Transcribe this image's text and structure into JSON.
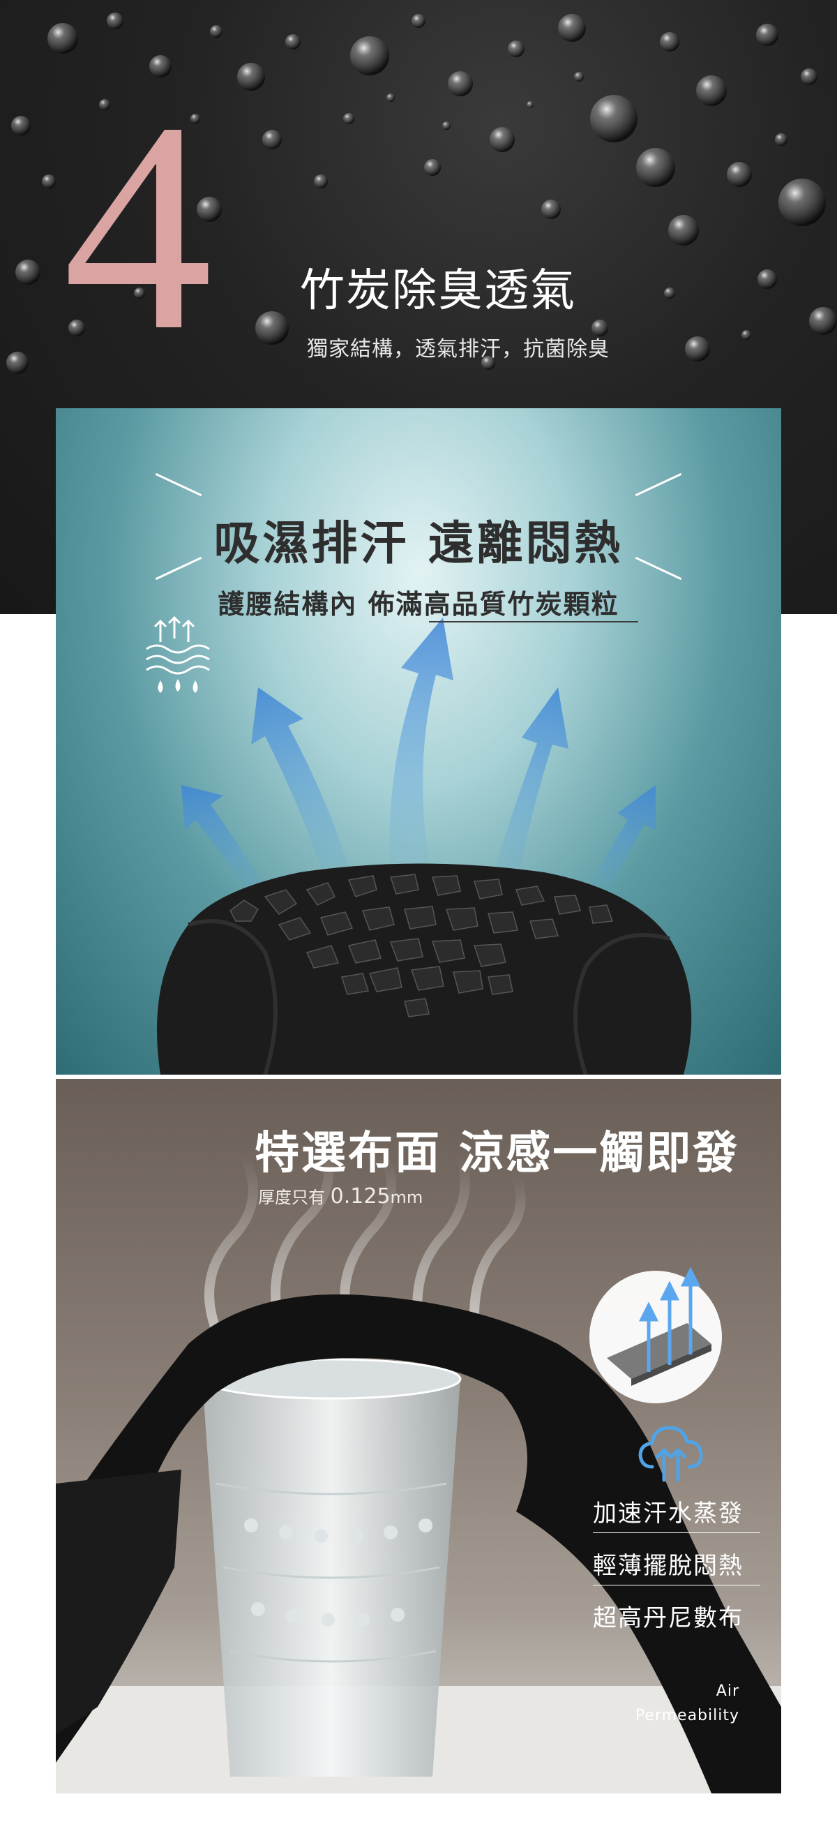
{
  "header": {
    "number": "4",
    "title": "竹炭除臭透氣",
    "subtitle": "獨家結構，透氣排汗，抗菌除臭"
  },
  "panel1": {
    "title": "吸濕排汗  遠離悶熱",
    "subtitle": "護腰結構內  佈滿高品質竹炭顆粒",
    "icon": "evaporation-icon"
  },
  "panel2": {
    "title": "特選布面  涼感一觸即發",
    "thickness_label": "厚度只有",
    "thickness_value": "0.125",
    "thickness_unit": "mm",
    "icon": "cloud-upload-icon",
    "features": [
      "加速汗水蒸發",
      "輕薄擺脫悶熱",
      "超高丹尼數布"
    ],
    "air_line1": "Air",
    "air_line2": "Permeability"
  },
  "colors": {
    "accent_pink": "#d9a4a2",
    "header_bg": "#1f1f1f",
    "teal_bg": "#5b9aa2",
    "blue_arrow": "#4a90d9",
    "brown_bg": "#8a7f76"
  }
}
